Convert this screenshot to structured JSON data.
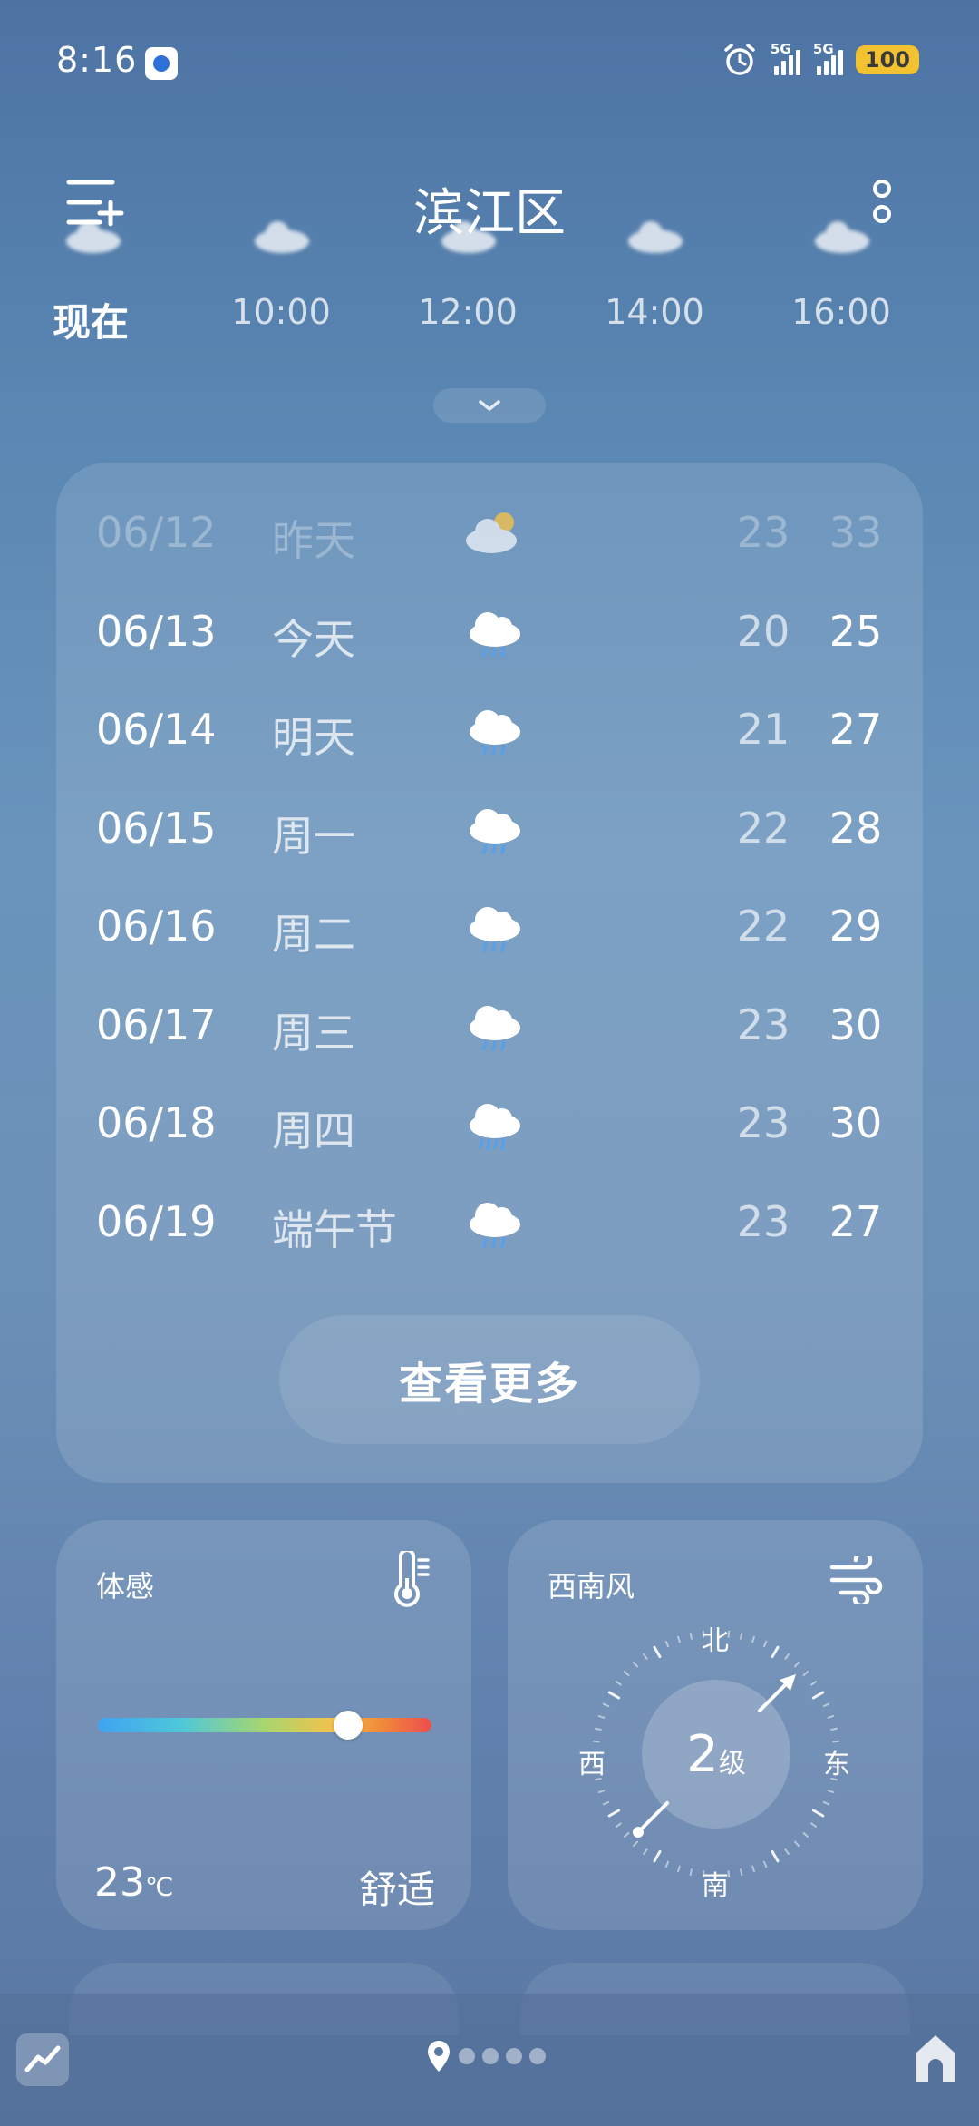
{
  "status_bar": {
    "time": "8:16",
    "signal_labels": [
      "5G",
      "5G"
    ],
    "battery": "100"
  },
  "header": {
    "title": "滨江区",
    "menu_icon": "add-city-menu-icon",
    "more_icon": "more-options-icon"
  },
  "hourly": {
    "now_label": "现在",
    "times": [
      "10:00",
      "12:00",
      "14:00",
      "16:00"
    ]
  },
  "forecast": {
    "rows": [
      {
        "date": "06/12",
        "day": "昨天",
        "icon": "partly-cloudy-icon",
        "low": "23",
        "high": "33",
        "faded": true
      },
      {
        "date": "06/13",
        "day": "今天",
        "icon": "rain-cloud-icon",
        "low": "20",
        "high": "25"
      },
      {
        "date": "06/14",
        "day": "明天",
        "icon": "rain-cloud-icon",
        "low": "21",
        "high": "27"
      },
      {
        "date": "06/15",
        "day": "周一",
        "icon": "rain-cloud-icon",
        "low": "22",
        "high": "28"
      },
      {
        "date": "06/16",
        "day": "周二",
        "icon": "rain-cloud-icon",
        "low": "22",
        "high": "29"
      },
      {
        "date": "06/17",
        "day": "周三",
        "icon": "rain-cloud-icon",
        "low": "23",
        "high": "30"
      },
      {
        "date": "06/18",
        "day": "周四",
        "icon": "heavy-rain-cloud-icon",
        "low": "23",
        "high": "30"
      },
      {
        "date": "06/19",
        "day": "端午节",
        "icon": "rain-cloud-icon",
        "low": "23",
        "high": "27"
      }
    ],
    "see_more": "查看更多"
  },
  "feels_like": {
    "label": "体感",
    "value": "23",
    "unit": "℃",
    "description": "舒适",
    "scale_position": 0.75
  },
  "wind": {
    "label": "西南风",
    "level": "2",
    "unit": "级",
    "north": "北",
    "south": "南",
    "east": "东",
    "west": "西"
  },
  "colors": {
    "battery": "#f2c230",
    "background_top": "#4d73a3",
    "background_mid": "#6a94bc"
  }
}
